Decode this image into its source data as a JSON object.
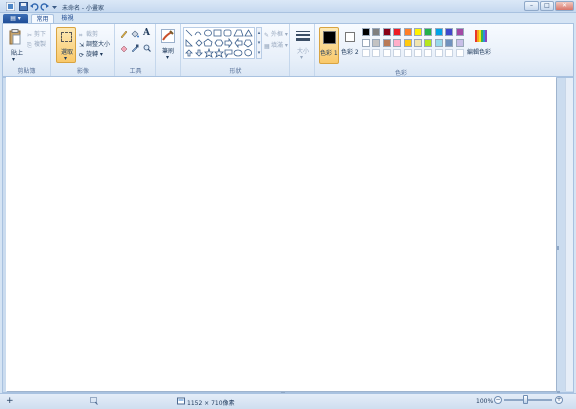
{
  "window": {
    "title": "未命名 - 小畫家",
    "controls": {
      "minimize": "–",
      "maximize": "□",
      "close": "✕"
    }
  },
  "quick_access": [
    "save-icon",
    "undo-icon",
    "redo-icon",
    "customize-dropdown-icon"
  ],
  "app_menu": {
    "label": "▤ ▾"
  },
  "tabs": [
    {
      "label": "常用",
      "selected": true
    },
    {
      "label": "檢視",
      "selected": false
    }
  ],
  "ribbon": {
    "clipboard": {
      "label": "剪貼簿",
      "paste": "貼上",
      "cut": "剪下",
      "copy": "複製"
    },
    "image": {
      "label": "影像",
      "select": "選取",
      "crop": "裁剪",
      "resize": "調整大小",
      "rotate": "旋轉"
    },
    "tools": {
      "label": "工具",
      "text_tool": "A"
    },
    "brushes": {
      "label": "筆刷"
    },
    "shapes": {
      "label": "形狀",
      "outline": "外框",
      "fill": "填滿"
    },
    "size": {
      "label": "大小"
    },
    "colors": {
      "label": "色彩",
      "color1": "色彩 1",
      "color2": "色彩 2",
      "edit": "編輯色彩",
      "color1_value": "#000000",
      "color2_value": "#ffffff",
      "palette_row1": [
        "#000000",
        "#7f7f7f",
        "#880015",
        "#ed1c24",
        "#ff7f27",
        "#fff200",
        "#22b14c",
        "#00a2e8",
        "#3f48cc",
        "#a349a4"
      ],
      "palette_row2": [
        "#ffffff",
        "#c3c3c3",
        "#b97a57",
        "#ffaec9",
        "#ffc90e",
        "#efe4b0",
        "#b5e61d",
        "#99d9ea",
        "#7092be",
        "#c8bfe7"
      ],
      "palette_row3": [
        "#ffffff",
        "#ffffff",
        "#ffffff",
        "#ffffff",
        "#ffffff",
        "#ffffff",
        "#ffffff",
        "#ffffff",
        "#ffffff",
        "#ffffff"
      ]
    }
  },
  "status": {
    "add": "+",
    "canvas_size": "1152 × 710像素",
    "zoom": "100%",
    "zoom_out": "−",
    "zoom_in": "+"
  }
}
